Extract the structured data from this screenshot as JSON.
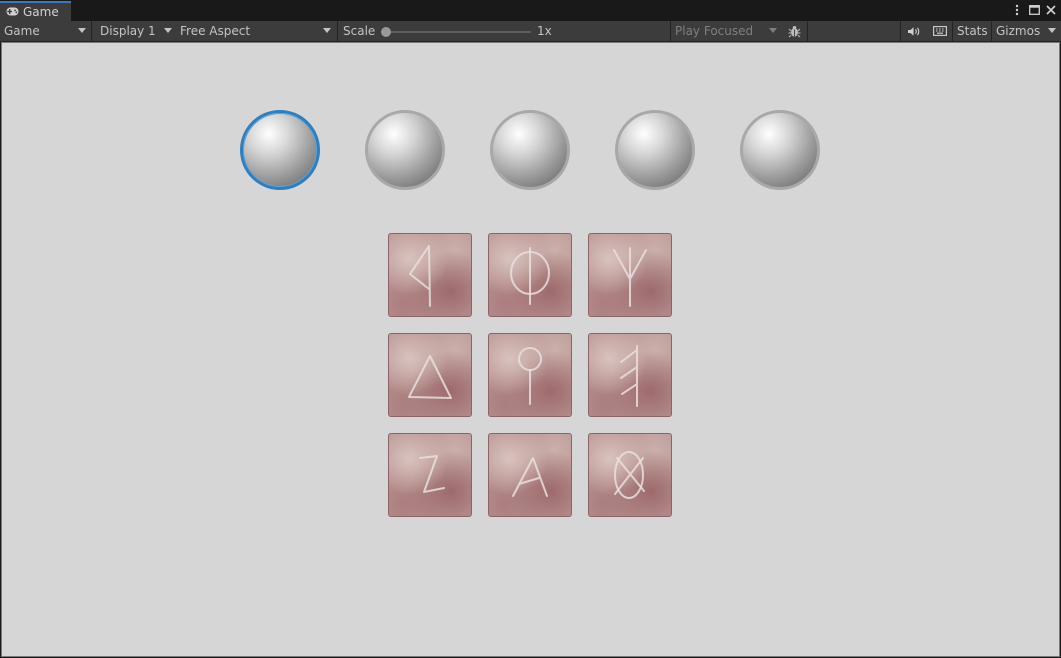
{
  "tab": {
    "title": "Game"
  },
  "toolbar": {
    "view_mode": "Game",
    "display": "Display 1",
    "aspect": "Free Aspect",
    "scale_label": "Scale",
    "scale_value": "1x",
    "play_mode": "Play Focused",
    "stats": "Stats",
    "gizmos": "Gizmos"
  },
  "game": {
    "spheres": [
      {
        "selected": true
      },
      {
        "selected": false
      },
      {
        "selected": false
      },
      {
        "selected": false
      },
      {
        "selected": false
      }
    ],
    "rune_tiles": [
      "kaunan",
      "ior",
      "algiz",
      "dagaz-triangle",
      "ring-staff",
      "ansuz",
      "zig",
      "ing-a",
      "othala-x"
    ]
  }
}
